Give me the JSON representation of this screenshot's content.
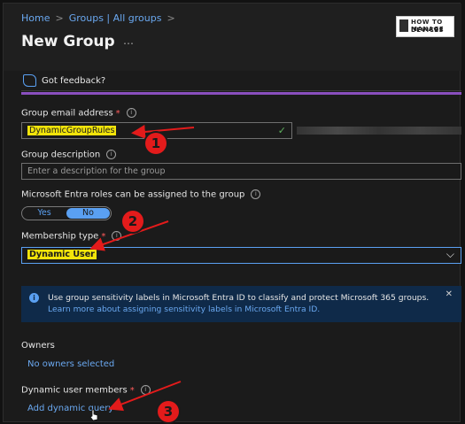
{
  "breadcrumb": {
    "home": "Home",
    "groups": "Groups | All groups",
    "sep1": ">",
    "sep2": ">"
  },
  "header": {
    "title": "New Group",
    "more": "…"
  },
  "logo": {
    "line1": "HOW TO MANAGE",
    "line2": "DEVICES"
  },
  "feedback": {
    "label": "Got feedback?"
  },
  "form": {
    "email": {
      "label": "Group email address",
      "required_mark": "*",
      "value": "DynamicGroupRules"
    },
    "description": {
      "label": "Group description",
      "placeholder": "Enter a description for the group"
    },
    "entra_roles": {
      "label": "Microsoft Entra roles can be assigned to the group",
      "options": [
        "Yes",
        "No"
      ],
      "selected": "No"
    },
    "membership": {
      "label": "Membership type",
      "required_mark": "*",
      "value": "Dynamic User"
    },
    "info_banner": {
      "text": "Use group sensitivity labels in Microsoft Entra ID to classify and protect Microsoft 365 groups.",
      "link": "Learn more about assigning sensitivity labels in Microsoft Entra ID.",
      "close": "✕"
    },
    "owners": {
      "label": "Owners",
      "link": "No owners selected"
    },
    "dynamic_members": {
      "label": "Dynamic user members",
      "required_mark": "*",
      "link": "Add dynamic query"
    }
  },
  "annotations": {
    "step1": "1",
    "step2": "2",
    "step3": "3"
  },
  "colors": {
    "accent": "#5aa0f2",
    "annotation": "#e31b1b",
    "highlight": "#f2e40a",
    "purple": "#8a4fbf"
  }
}
